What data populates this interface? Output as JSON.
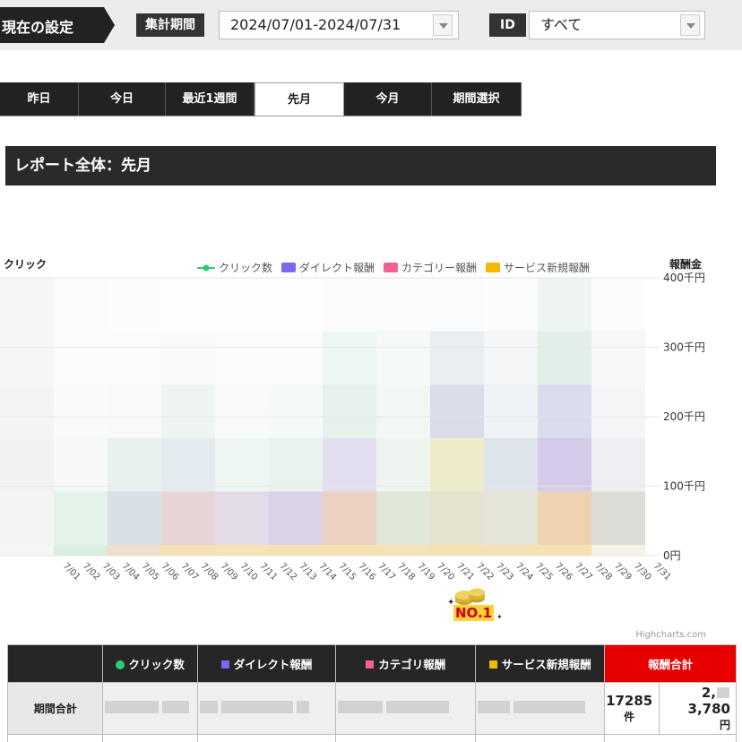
{
  "settings": {
    "label": "現在の設定",
    "period_chip": "集計期間",
    "period_value": "2024/07/01-2024/07/31",
    "id_chip": "ID",
    "id_value": "すべて"
  },
  "tabs": [
    {
      "label": "昨日"
    },
    {
      "label": "今日"
    },
    {
      "label": "最近1週間"
    },
    {
      "label": "先月",
      "active": true
    },
    {
      "label": "今月"
    },
    {
      "label": "期間選択"
    }
  ],
  "report_title": "レポート全体：先月",
  "chart_data": {
    "type": "bar",
    "left_axis_title": "クリック",
    "right_axis_title": "報酬金",
    "right_ticks": [
      "400千円",
      "300千円",
      "200千円",
      "100千円",
      "0円"
    ],
    "right_tick_values": [
      400,
      300,
      200,
      100,
      0
    ],
    "categories": [
      "7/01",
      "7/02",
      "7/03",
      "7/04",
      "7/05",
      "7/06",
      "7/07",
      "7/08",
      "7/09",
      "7/10",
      "7/11",
      "7/12",
      "7/13",
      "7/14",
      "7/15",
      "7/16",
      "7/17",
      "7/18",
      "7/19",
      "7/20",
      "7/21",
      "7/22",
      "7/23",
      "7/24",
      "7/25",
      "7/26",
      "7/27",
      "7/28",
      "7/29",
      "7/30",
      "7/31"
    ],
    "legend": [
      {
        "name": "クリック数",
        "color": "#2ecc71",
        "kind": "line"
      },
      {
        "name": "ダイレクト報酬",
        "color": "#7b68ee",
        "kind": "box"
      },
      {
        "name": "カテゴリー報酬",
        "color": "#f06292",
        "kind": "box"
      },
      {
        "name": "サービス新規報酬",
        "color": "#f5b800",
        "kind": "box"
      }
    ],
    "credit": "Highcharts.com"
  },
  "badge_text": "NO.1",
  "table": {
    "headers": [
      "クリック数",
      "ダイレクト報酬",
      "カテゴリ報酬",
      "サービス新規報酬",
      "報酬合計"
    ],
    "header_colors": [
      "#2ecc71",
      "#7b68ee",
      "#f06292",
      "#f5b800"
    ],
    "row_label": "期間合計",
    "clicks_total": "17285",
    "clicks_unit": "件",
    "reward_total": "2,",
    "reward_total_tail": "3,780",
    "reward_unit": "円"
  }
}
